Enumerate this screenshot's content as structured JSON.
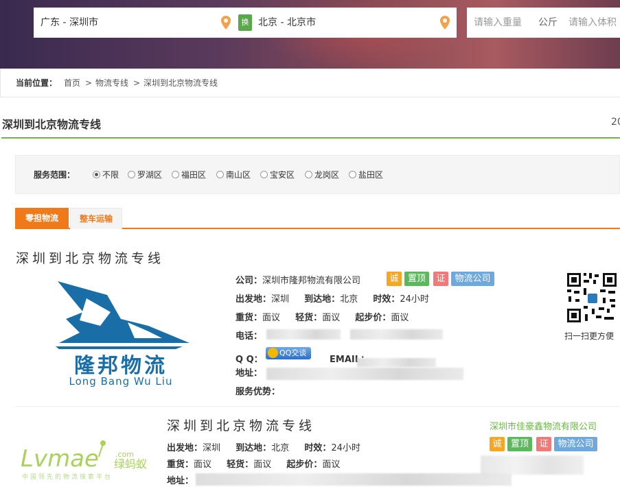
{
  "search": {
    "from": "广东 - 深圳市",
    "swap_label": "换",
    "to": "北京 - 北京市",
    "weight_placeholder": "请输入重量",
    "weight_unit": "公斤",
    "volume_placeholder": "请输入体积"
  },
  "breadcrumb": {
    "label": "当前位置：",
    "items": [
      "首页",
      "物流专线",
      "深圳到北京物流专线"
    ],
    "separator": ">"
  },
  "section": {
    "title": "深圳到北京物流专线",
    "date_fragment": "20"
  },
  "filter": {
    "label": "服务范围：",
    "options": [
      "不限",
      "罗湖区",
      "福田区",
      "南山区",
      "宝安区",
      "龙岗区",
      "盐田区"
    ],
    "selected": "不限"
  },
  "tabs": [
    {
      "label": "零担物流",
      "active": true
    },
    {
      "label": "整车运输",
      "active": false
    }
  ],
  "card1": {
    "title": "深圳到北京物流专线",
    "logo_text_cn": "隆邦物流",
    "logo_text_en": "Long Bang Wu Liu",
    "company_label": "公司：",
    "company": "深圳市隆邦物流有限公司",
    "badges": [
      {
        "text": "诚",
        "color": "#f5a623"
      },
      {
        "text": "置顶",
        "color": "#5cb85c"
      },
      {
        "text": "证",
        "color": "#f07a7a"
      },
      {
        "text": "物流公司",
        "color": "#6fa8dc"
      }
    ],
    "origin_label": "出发地：",
    "origin": "深圳",
    "dest_label": "到达地：",
    "dest": "北京",
    "time_label": "时效：",
    "time": "24小时",
    "heavy_label": "重货：",
    "heavy": "面议",
    "light_label": "轻货：",
    "light": "面议",
    "min_label": "起步价：",
    "min": "面议",
    "phone_label": "电话：",
    "qq_label": "Q Q：",
    "qq_button": "QQ交谈",
    "email_label": "EMAIL：",
    "address_label": "地址：",
    "advantage_label": "服务优势：",
    "qr_caption": "扫一扫更方便"
  },
  "card2": {
    "title": "深圳到北京物流专线",
    "company": "深圳市佳豪鑫物流有限公司",
    "logo_text_en": "Lvmae",
    "logo_com": ".com",
    "logo_text_cn": "绿蚂蚁",
    "logo_slogan": "中国领先的物流搜索平台",
    "badges": [
      {
        "text": "诚",
        "color": "#f5a623"
      },
      {
        "text": "置顶",
        "color": "#5cb85c"
      },
      {
        "text": "证",
        "color": "#f07a7a"
      },
      {
        "text": "物流公司",
        "color": "#6fa8dc"
      }
    ],
    "origin_label": "出发地：",
    "origin": "深圳",
    "dest_label": "到达地：",
    "dest": "北京",
    "time_label": "时效：",
    "time": "24小时",
    "heavy_label": "重货：",
    "heavy": "面议",
    "light_label": "轻货：",
    "light": "面议",
    "min_label": "起步价：",
    "min": "面议",
    "address_label": "地址："
  }
}
